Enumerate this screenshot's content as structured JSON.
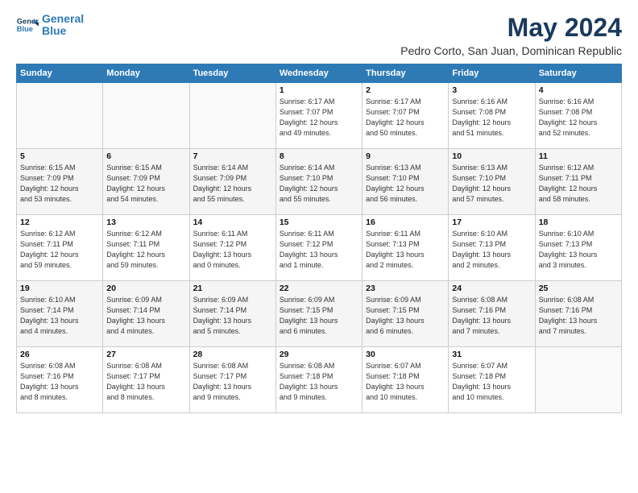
{
  "logo": {
    "line1": "General",
    "line2": "Blue"
  },
  "calendar": {
    "title": "May 2024",
    "subtitle": "Pedro Corto, San Juan, Dominican Republic",
    "headers": [
      "Sunday",
      "Monday",
      "Tuesday",
      "Wednesday",
      "Thursday",
      "Friday",
      "Saturday"
    ],
    "weeks": [
      [
        {
          "day": "",
          "info": ""
        },
        {
          "day": "",
          "info": ""
        },
        {
          "day": "",
          "info": ""
        },
        {
          "day": "1",
          "info": "Sunrise: 6:17 AM\nSunset: 7:07 PM\nDaylight: 12 hours\nand 49 minutes."
        },
        {
          "day": "2",
          "info": "Sunrise: 6:17 AM\nSunset: 7:07 PM\nDaylight: 12 hours\nand 50 minutes."
        },
        {
          "day": "3",
          "info": "Sunrise: 6:16 AM\nSunset: 7:08 PM\nDaylight: 12 hours\nand 51 minutes."
        },
        {
          "day": "4",
          "info": "Sunrise: 6:16 AM\nSunset: 7:08 PM\nDaylight: 12 hours\nand 52 minutes."
        }
      ],
      [
        {
          "day": "5",
          "info": "Sunrise: 6:15 AM\nSunset: 7:09 PM\nDaylight: 12 hours\nand 53 minutes."
        },
        {
          "day": "6",
          "info": "Sunrise: 6:15 AM\nSunset: 7:09 PM\nDaylight: 12 hours\nand 54 minutes."
        },
        {
          "day": "7",
          "info": "Sunrise: 6:14 AM\nSunset: 7:09 PM\nDaylight: 12 hours\nand 55 minutes."
        },
        {
          "day": "8",
          "info": "Sunrise: 6:14 AM\nSunset: 7:10 PM\nDaylight: 12 hours\nand 55 minutes."
        },
        {
          "day": "9",
          "info": "Sunrise: 6:13 AM\nSunset: 7:10 PM\nDaylight: 12 hours\nand 56 minutes."
        },
        {
          "day": "10",
          "info": "Sunrise: 6:13 AM\nSunset: 7:10 PM\nDaylight: 12 hours\nand 57 minutes."
        },
        {
          "day": "11",
          "info": "Sunrise: 6:12 AM\nSunset: 7:11 PM\nDaylight: 12 hours\nand 58 minutes."
        }
      ],
      [
        {
          "day": "12",
          "info": "Sunrise: 6:12 AM\nSunset: 7:11 PM\nDaylight: 12 hours\nand 59 minutes."
        },
        {
          "day": "13",
          "info": "Sunrise: 6:12 AM\nSunset: 7:11 PM\nDaylight: 12 hours\nand 59 minutes."
        },
        {
          "day": "14",
          "info": "Sunrise: 6:11 AM\nSunset: 7:12 PM\nDaylight: 13 hours\nand 0 minutes."
        },
        {
          "day": "15",
          "info": "Sunrise: 6:11 AM\nSunset: 7:12 PM\nDaylight: 13 hours\nand 1 minute."
        },
        {
          "day": "16",
          "info": "Sunrise: 6:11 AM\nSunset: 7:13 PM\nDaylight: 13 hours\nand 2 minutes."
        },
        {
          "day": "17",
          "info": "Sunrise: 6:10 AM\nSunset: 7:13 PM\nDaylight: 13 hours\nand 2 minutes."
        },
        {
          "day": "18",
          "info": "Sunrise: 6:10 AM\nSunset: 7:13 PM\nDaylight: 13 hours\nand 3 minutes."
        }
      ],
      [
        {
          "day": "19",
          "info": "Sunrise: 6:10 AM\nSunset: 7:14 PM\nDaylight: 13 hours\nand 4 minutes."
        },
        {
          "day": "20",
          "info": "Sunrise: 6:09 AM\nSunset: 7:14 PM\nDaylight: 13 hours\nand 4 minutes."
        },
        {
          "day": "21",
          "info": "Sunrise: 6:09 AM\nSunset: 7:14 PM\nDaylight: 13 hours\nand 5 minutes."
        },
        {
          "day": "22",
          "info": "Sunrise: 6:09 AM\nSunset: 7:15 PM\nDaylight: 13 hours\nand 6 minutes."
        },
        {
          "day": "23",
          "info": "Sunrise: 6:09 AM\nSunset: 7:15 PM\nDaylight: 13 hours\nand 6 minutes."
        },
        {
          "day": "24",
          "info": "Sunrise: 6:08 AM\nSunset: 7:16 PM\nDaylight: 13 hours\nand 7 minutes."
        },
        {
          "day": "25",
          "info": "Sunrise: 6:08 AM\nSunset: 7:16 PM\nDaylight: 13 hours\nand 7 minutes."
        }
      ],
      [
        {
          "day": "26",
          "info": "Sunrise: 6:08 AM\nSunset: 7:16 PM\nDaylight: 13 hours\nand 8 minutes."
        },
        {
          "day": "27",
          "info": "Sunrise: 6:08 AM\nSunset: 7:17 PM\nDaylight: 13 hours\nand 8 minutes."
        },
        {
          "day": "28",
          "info": "Sunrise: 6:08 AM\nSunset: 7:17 PM\nDaylight: 13 hours\nand 9 minutes."
        },
        {
          "day": "29",
          "info": "Sunrise: 6:08 AM\nSunset: 7:18 PM\nDaylight: 13 hours\nand 9 minutes."
        },
        {
          "day": "30",
          "info": "Sunrise: 6:07 AM\nSunset: 7:18 PM\nDaylight: 13 hours\nand 10 minutes."
        },
        {
          "day": "31",
          "info": "Sunrise: 6:07 AM\nSunset: 7:18 PM\nDaylight: 13 hours\nand 10 minutes."
        },
        {
          "day": "",
          "info": ""
        }
      ]
    ]
  }
}
